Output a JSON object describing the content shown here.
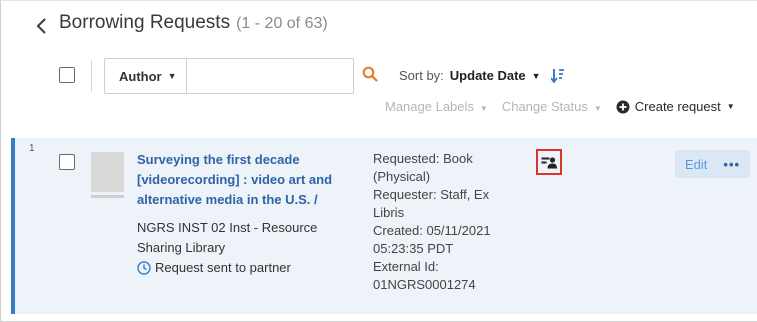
{
  "header": {
    "title": "Borrowing Requests",
    "range": "(1 - 20 of 63)"
  },
  "toolbar": {
    "filter_field": "Author",
    "search_value": "",
    "sort_label": "Sort by:",
    "sort_value": "Update Date"
  },
  "actions": {
    "manage_labels": "Manage Labels",
    "change_status": "Change Status",
    "create_request": "Create request"
  },
  "rows": [
    {
      "index": "1",
      "title_lines": [
        "Surveying the first decade",
        "[videorecording] : video art and",
        "alternative media in the U.S. /"
      ],
      "library_lines": [
        "NGRS INST 02 Inst - Resource",
        "Sharing Library"
      ],
      "status": "Request sent to partner",
      "details_lines": [
        "Requested: Book",
        "(Physical)",
        "Requester: Staff, Ex",
        "Libris",
        "Created: 05/11/2021",
        "05:23:35 PDT",
        "External Id:",
        "01NGRS0001274"
      ],
      "edit_label": "Edit",
      "more_label": "•••"
    }
  ],
  "colors": {
    "accent": "#2f63a8",
    "row_bg": "#edf3f9",
    "row_border": "#3a7cc3",
    "highlight": "#d9362b",
    "muted": "#b5b5b5"
  },
  "icons": {
    "back": "chevron-left-icon",
    "search": "search-icon",
    "sort_direction": "sort-descending-icon",
    "create": "plus-circle-icon",
    "status": "clock-icon",
    "requester_type": "person-card-icon"
  }
}
